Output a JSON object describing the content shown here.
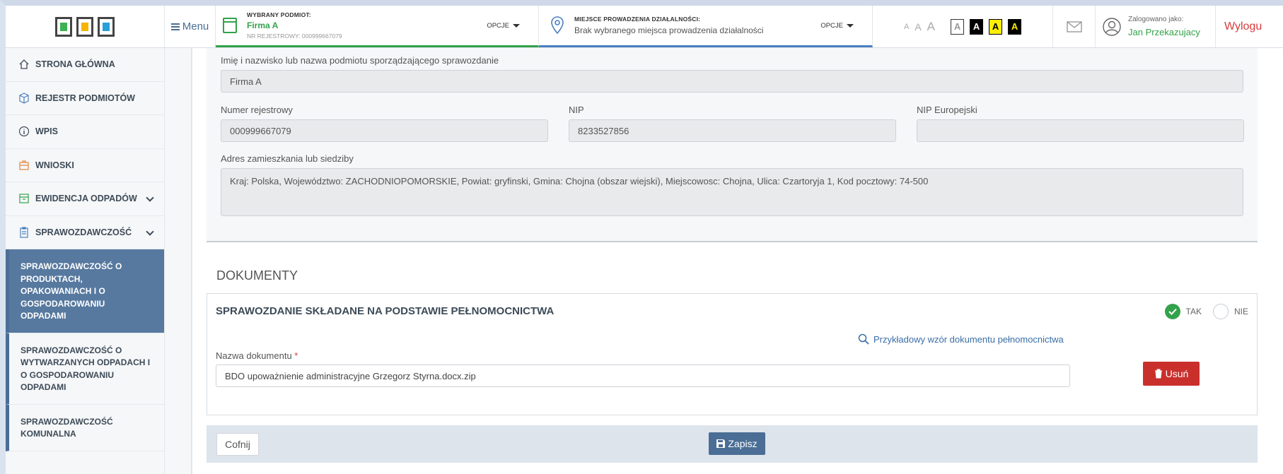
{
  "header": {
    "menu_label": "Menu",
    "entity": {
      "heading": "WYBRANY PODMIOT:",
      "name": "Firma A",
      "reg": "NR REJESTROWY: 000999667079",
      "options": "OPCJE"
    },
    "location": {
      "heading": "MIEJSCE PROWADZENIA DZIAŁALNOŚCI:",
      "value": "Brak wybranego miejsca prowadzenia działalności",
      "options": "OPCJE"
    },
    "font_sizes": [
      "A",
      "A",
      "A"
    ],
    "contrast": [
      "A",
      "A",
      "A",
      "A"
    ],
    "user": {
      "label": "Zalogowano jako:",
      "name": "Jan Przekazujacy"
    },
    "logout": "Wylogu"
  },
  "sidebar": {
    "items": [
      {
        "label": "STRONA GŁÓWNA",
        "icon": "home-icon"
      },
      {
        "label": "REJESTR PODMIOTÓW",
        "icon": "cube-icon"
      },
      {
        "label": "WPIS",
        "icon": "info-icon"
      },
      {
        "label": "WNIOSKI",
        "icon": "briefcase-icon"
      },
      {
        "label": "EWIDENCJA ODPADÓW",
        "icon": "archive-icon"
      },
      {
        "label": "SPRAWOZDAWCZOŚĆ",
        "icon": "clipboard-icon"
      }
    ],
    "subitems": [
      {
        "label": "SPRAWOZDAWCZOŚĆ O PRODUKTACH, OPAKOWANIACH I O GOSPODAROWANIU ODPADAMI"
      },
      {
        "label": "SPRAWOZDAWCZOŚĆ O WYTWARZANYCH ODPADACH I O GOSPODAROWANIU ODPADAMI"
      },
      {
        "label": "SPRAWOZDAWCZOŚĆ KOMUNALNA"
      }
    ]
  },
  "form": {
    "name_label": "Imię i nazwisko lub nazwa podmiotu sporządzającego sprawozdanie",
    "name_value": "Firma A",
    "reg_label": "Numer rejestrowy",
    "reg_value": "000999667079",
    "nip_label": "NIP",
    "nip_value": "8233527856",
    "nip_eu_label": "NIP Europejski",
    "nip_eu_value": "",
    "address_label": "Adres zamieszkania lub siedziby",
    "address_value": "Kraj: Polska, Województwo: ZACHODNIOPOMORSKIE, Powiat: gryfinski, Gmina: Chojna (obszar wiejski), Miejscowosc: Chojna, Ulica: Czartoryja 1, Kod pocztowy: 74-500"
  },
  "documents": {
    "title": "DOKUMENTY",
    "pelnomocnictwo_title": "SPRAWOZDANIE SKŁADANE NA PODSTAWIE PEŁNOMOCNICTWA",
    "yes_label": "TAK",
    "no_label": "NIE",
    "example_link": "Przykładowy wzór dokumentu pełnomocnictwa",
    "docname_label": "Nazwa dokumentu",
    "docname_value": "BDO upoważnienie administracyjne Grzegorz Styrna.docx.zip",
    "delete_label": "Usuń"
  },
  "footer": {
    "back_label": "Cofnij",
    "save_label": "Zapisz"
  },
  "colors": {
    "accent_green": "#33a24a",
    "primary_blue": "#4a6e95",
    "danger_red": "#c9302c"
  }
}
